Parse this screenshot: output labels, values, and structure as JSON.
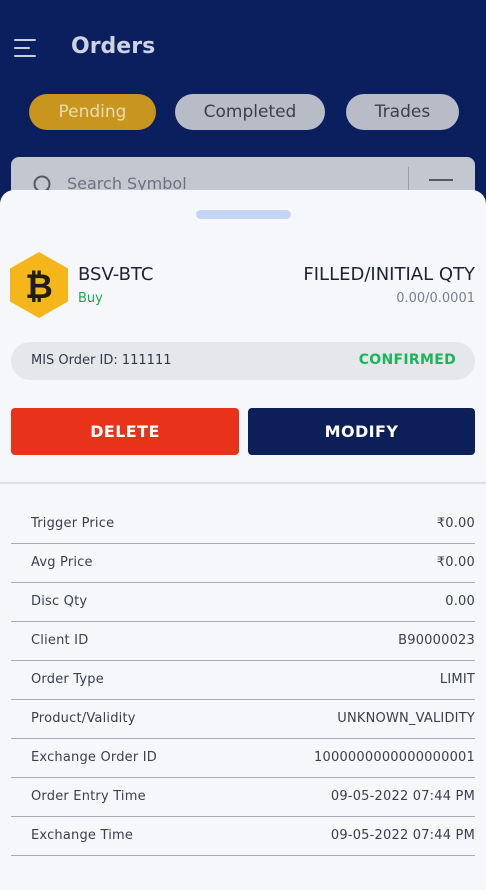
{
  "header": {
    "title": "Orders",
    "tabs": [
      {
        "label": "Pending",
        "active": true
      },
      {
        "label": "Completed",
        "active": false
      },
      {
        "label": "Trades",
        "active": false
      }
    ],
    "search": {
      "placeholder": "Search Symbol"
    }
  },
  "order": {
    "symbol": "BSV-BTC",
    "side": "Buy",
    "coin_icon": "bitcoin-icon",
    "qty_label": "FILLED/INITIAL QTY",
    "qty_value": "0.00/0.0001",
    "order_id_text": "MIS Order ID: 111111",
    "status": "CONFIRMED",
    "actions": {
      "delete": "DELETE",
      "modify": "MODIFY"
    }
  },
  "details": [
    {
      "label": "Trigger Price",
      "value": "₹0.00"
    },
    {
      "label": "Avg Price",
      "value": "₹0.00"
    },
    {
      "label": "Disc Qty",
      "value": "0.00"
    },
    {
      "label": "Client ID",
      "value": "B90000023"
    },
    {
      "label": "Order Type",
      "value": "LIMIT"
    },
    {
      "label": "Product/Validity",
      "value": "UNKNOWN_VALIDITY"
    },
    {
      "label": "Exchange Order ID",
      "value": "1000000000000000001"
    },
    {
      "label": "Order Entry Time",
      "value": "09-05-2022 07:44 PM"
    },
    {
      "label": "Exchange Time",
      "value": "09-05-2022 07:44 PM"
    }
  ],
  "colors": {
    "header_bg": "#0b1f5e",
    "active_tab": "#c8961f",
    "delete": "#e8331a",
    "modify": "#0d1f57",
    "confirmed": "#19b659",
    "buy": "#18a948",
    "coin": "#f4b61a"
  }
}
